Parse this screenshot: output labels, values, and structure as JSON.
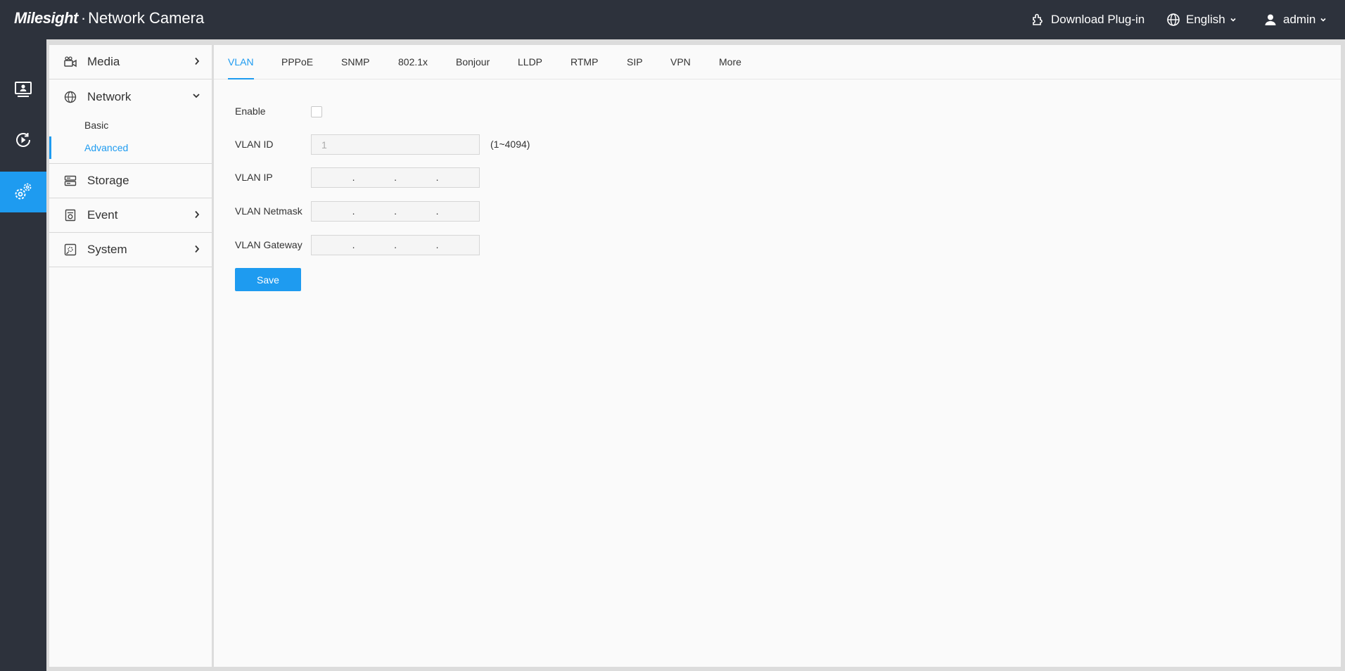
{
  "header": {
    "brand_logo": "Milesight",
    "brand_separator": "·",
    "brand_title": "Network Camera",
    "download_plugin": "Download Plug-in",
    "language": "English",
    "user": "admin"
  },
  "rail": {
    "items": [
      {
        "icon": "live-view-icon",
        "active": false
      },
      {
        "icon": "playback-icon",
        "active": false
      },
      {
        "icon": "settings-icon",
        "active": true
      }
    ]
  },
  "menu": {
    "media": "Media",
    "network": "Network",
    "network_sub": [
      "Basic",
      "Advanced"
    ],
    "storage": "Storage",
    "event": "Event",
    "system": "System"
  },
  "tabs": [
    "VLAN",
    "PPPoE",
    "SNMP",
    "802.1x",
    "Bonjour",
    "LLDP",
    "RTMP",
    "SIP",
    "VPN",
    "More"
  ],
  "active_tab": "VLAN",
  "form": {
    "enable_label": "Enable",
    "enable_checked": false,
    "vlan_id_label": "VLAN ID",
    "vlan_id_value": "1",
    "vlan_id_range": "(1~4094)",
    "vlan_ip_label": "VLAN IP",
    "vlan_netmask_label": "VLAN Netmask",
    "vlan_gateway_label": "VLAN Gateway",
    "ip_separator": ".",
    "save_label": "Save"
  },
  "colors": {
    "accent": "#1e9bf0",
    "header_bg": "#2d323c",
    "panel_bg": "#fafafa"
  }
}
